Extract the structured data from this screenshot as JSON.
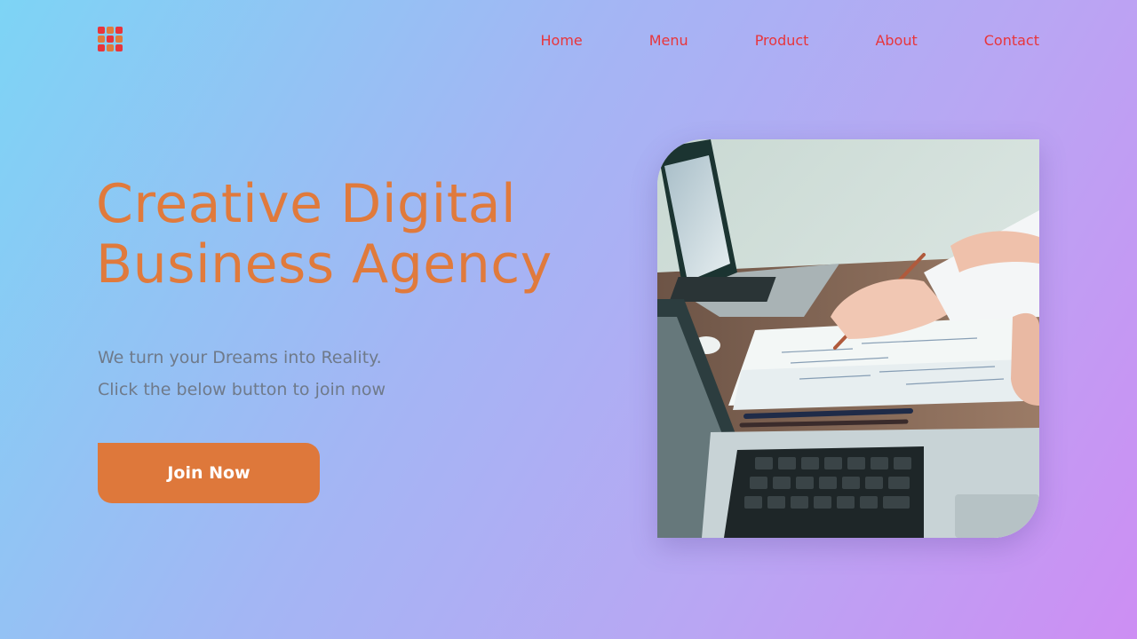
{
  "header": {
    "logo_icon": "grid-logo-icon",
    "logo_colors": [
      "#e8353b",
      "#e07a3c",
      "#d4a017"
    ],
    "nav": [
      {
        "label": "Home"
      },
      {
        "label": "Menu"
      },
      {
        "label": "Product"
      },
      {
        "label": "About"
      },
      {
        "label": "Contact"
      }
    ]
  },
  "hero": {
    "title_line1": "Creative Digital",
    "title_line2": "Business Agency",
    "subtitle_line1": "We turn your Dreams into Reality.",
    "subtitle_line2": "Click the below button to join now",
    "cta_label": "Join Now",
    "image_icon": "laptops-meeting-photo"
  },
  "colors": {
    "accent": "#de783b",
    "nav_text": "#e8353b",
    "subtitle_text": "#6f7a8a",
    "bg_start": "#7dd4f5",
    "bg_end": "#cd8ef3"
  }
}
